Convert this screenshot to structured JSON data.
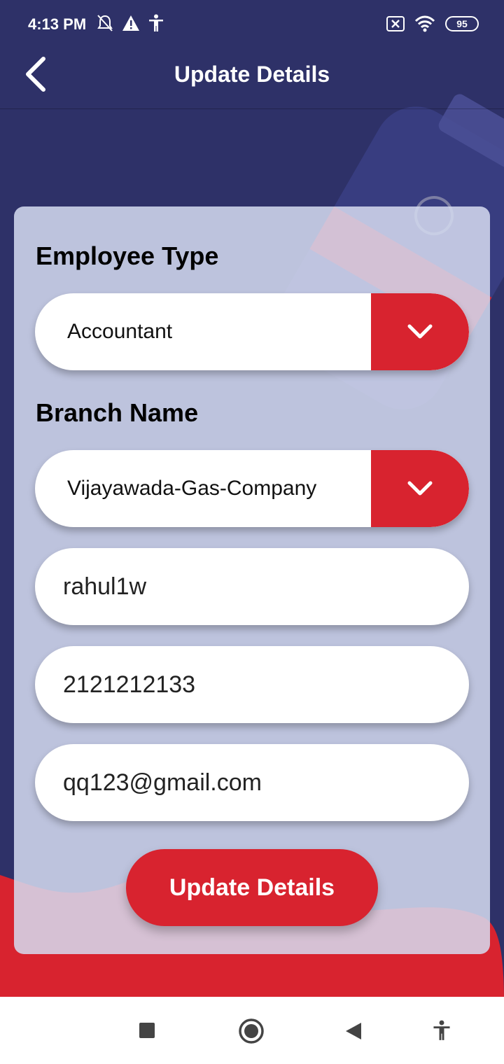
{
  "status_bar": {
    "time": "4:13 PM",
    "left_icons": [
      "bell-off-icon",
      "warning-icon",
      "accessibility-icon"
    ],
    "right_icons": [
      "sim-off-icon",
      "wifi-icon"
    ],
    "battery": "95"
  },
  "app_bar": {
    "title": "Update Details",
    "back_icon": "chevron-left-icon"
  },
  "form": {
    "employee_type_label": "Employee Type",
    "employee_type_value": "Accountant",
    "branch_name_label": "Branch Name",
    "branch_name_value": "Vijayawada-Gas-Company",
    "username_value": "rahul1w",
    "phone_value": "2121212133",
    "email_value": "qq123@gmail.com",
    "submit_label": "Update Details"
  },
  "nav_bar": {
    "icons": [
      "recents-square-icon",
      "home-circle-icon",
      "back-triangle-icon",
      "accessibility-icon"
    ]
  },
  "colors": {
    "primary": "#2e3168",
    "accent": "#d8232f",
    "card": "#d5dbf0"
  }
}
